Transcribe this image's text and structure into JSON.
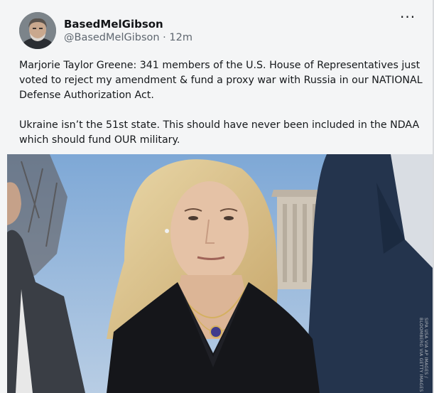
{
  "post": {
    "author_name": "BasedMelGibson",
    "handle": "@BasedMelGibson",
    "separator": "·",
    "time_ago": "12m",
    "more_menu": "···",
    "paragraphs": [
      "Marjorie Taylor Greene: 341 members of the U.S. House of Representatives just voted to reject my amendment & fund a proxy war with Russia in our NATIONAL Defense Authorization Act.",
      "Ukraine isn’t the 51st state. This should have never been included in the NDAA which should fund OUR military."
    ],
    "image": {
      "icon": "photo",
      "credit": "SIPA USA VIA AP IMAGES / BLOOMBERG VIA GETTY IMAGES"
    }
  },
  "colors": {
    "card_bg": "#f4f5f6",
    "text_primary": "#15181b",
    "text_secondary": "#5f6770"
  }
}
